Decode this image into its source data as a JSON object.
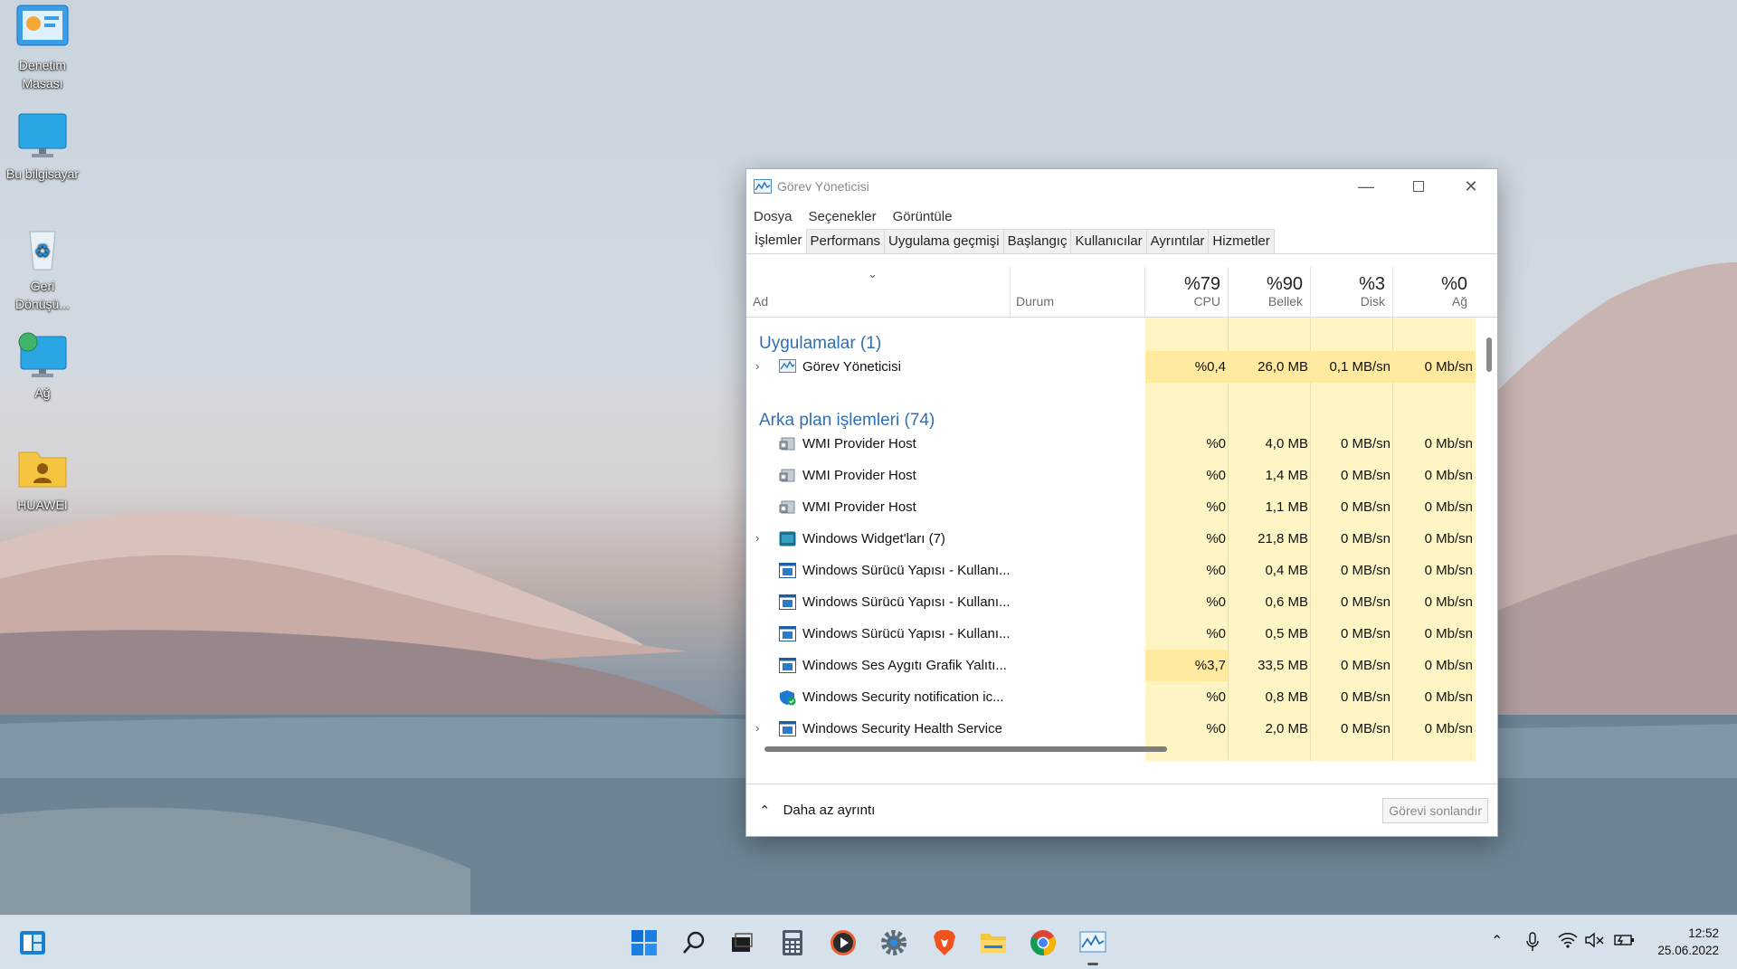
{
  "desktop": {
    "icons": [
      {
        "label_line1": "Denetim",
        "label_line2": "Masası"
      },
      {
        "label_line1": "Bu bilgisayar",
        "label_line2": ""
      },
      {
        "label_line1": "Geri",
        "label_line2": "Dönüşü..."
      },
      {
        "label_line1": "Ağ",
        "label_line2": ""
      },
      {
        "label_line1": "HUAWEI",
        "label_line2": ""
      }
    ]
  },
  "window": {
    "title": "Görev Yöneticisi",
    "menu": [
      "Dosya",
      "Seçenekler",
      "Görüntüle"
    ],
    "tabs": [
      "İşlemler",
      "Performans",
      "Uygulama geçmişi",
      "Başlangıç",
      "Kullanıcılar",
      "Ayrıntılar",
      "Hizmetler"
    ],
    "active_tab": "İşlemler",
    "columns": {
      "name": "Ad",
      "status": "Durum",
      "cpu": {
        "pct": "%79",
        "label": "CPU"
      },
      "memory": {
        "pct": "%90",
        "label": "Bellek"
      },
      "disk": {
        "pct": "%3",
        "label": "Disk"
      },
      "network": {
        "pct": "%0",
        "label": "Ağ"
      }
    },
    "groups": [
      {
        "title": "Uygulamalar (1)"
      },
      {
        "title": "Arka plan işlemleri (74)"
      }
    ],
    "rows": [
      {
        "name": "Görev Yöneticisi",
        "expandable": true,
        "icon": "task-manager-icon",
        "cpu": "%0,4",
        "memory": "26,0 MB",
        "disk": "0,1 MB/sn",
        "network": "0 Mb/sn"
      },
      {
        "name": "WMI Provider Host",
        "expandable": false,
        "icon": "wmi-icon",
        "cpu": "%0",
        "memory": "4,0 MB",
        "disk": "0 MB/sn",
        "network": "0 Mb/sn"
      },
      {
        "name": "WMI Provider Host",
        "expandable": false,
        "icon": "wmi-icon",
        "cpu": "%0",
        "memory": "1,4 MB",
        "disk": "0 MB/sn",
        "network": "0 Mb/sn"
      },
      {
        "name": "WMI Provider Host",
        "expandable": false,
        "icon": "wmi-icon",
        "cpu": "%0",
        "memory": "1,1 MB",
        "disk": "0 MB/sn",
        "network": "0 Mb/sn"
      },
      {
        "name": "Windows Widget'ları (7)",
        "expandable": true,
        "icon": "widgets-icon",
        "cpu": "%0",
        "memory": "21,8 MB",
        "disk": "0 MB/sn",
        "network": "0 Mb/sn"
      },
      {
        "name": "Windows Sürücü Yapısı - Kullanı...",
        "expandable": false,
        "icon": "app-window-icon",
        "cpu": "%0",
        "memory": "0,4 MB",
        "disk": "0 MB/sn",
        "network": "0 Mb/sn"
      },
      {
        "name": "Windows Sürücü Yapısı - Kullanı...",
        "expandable": false,
        "icon": "app-window-icon",
        "cpu": "%0",
        "memory": "0,6 MB",
        "disk": "0 MB/sn",
        "network": "0 Mb/sn"
      },
      {
        "name": "Windows Sürücü Yapısı - Kullanı...",
        "expandable": false,
        "icon": "app-window-icon",
        "cpu": "%0",
        "memory": "0,5 MB",
        "disk": "0 MB/sn",
        "network": "0 Mb/sn"
      },
      {
        "name": "Windows Ses Aygıtı Grafik Yalıtı...",
        "expandable": false,
        "icon": "app-window-icon",
        "cpu": "%3,7",
        "memory": "33,5 MB",
        "disk": "0 MB/sn",
        "network": "0 Mb/sn"
      },
      {
        "name": "Windows Security notification ic...",
        "expandable": false,
        "icon": "security-shield-icon",
        "cpu": "%0",
        "memory": "0,8 MB",
        "disk": "0 MB/sn",
        "network": "0 Mb/sn"
      },
      {
        "name": "Windows Security Health Service",
        "expandable": true,
        "icon": "app-window-icon",
        "cpu": "%0",
        "memory": "2,0 MB",
        "disk": "0 MB/sn",
        "network": "0 Mb/sn"
      }
    ],
    "footer": {
      "fewer_details": "Daha az ayrıntı",
      "end_task": "Görevi sonlandır"
    }
  },
  "taskbar": {
    "clock_time": "12:52",
    "clock_date": "25.06.2022",
    "apps": [
      "widgets-icon",
      "start-icon",
      "search-icon",
      "task-view-icon",
      "calculator-icon",
      "media-player-icon",
      "settings-icon",
      "brave-icon",
      "file-explorer-icon",
      "chrome-icon",
      "task-manager-icon"
    ]
  },
  "colors": {
    "accent": "#2e6fb5",
    "heat": "#fff4c4",
    "heat_strong": "#ffeaa0"
  }
}
